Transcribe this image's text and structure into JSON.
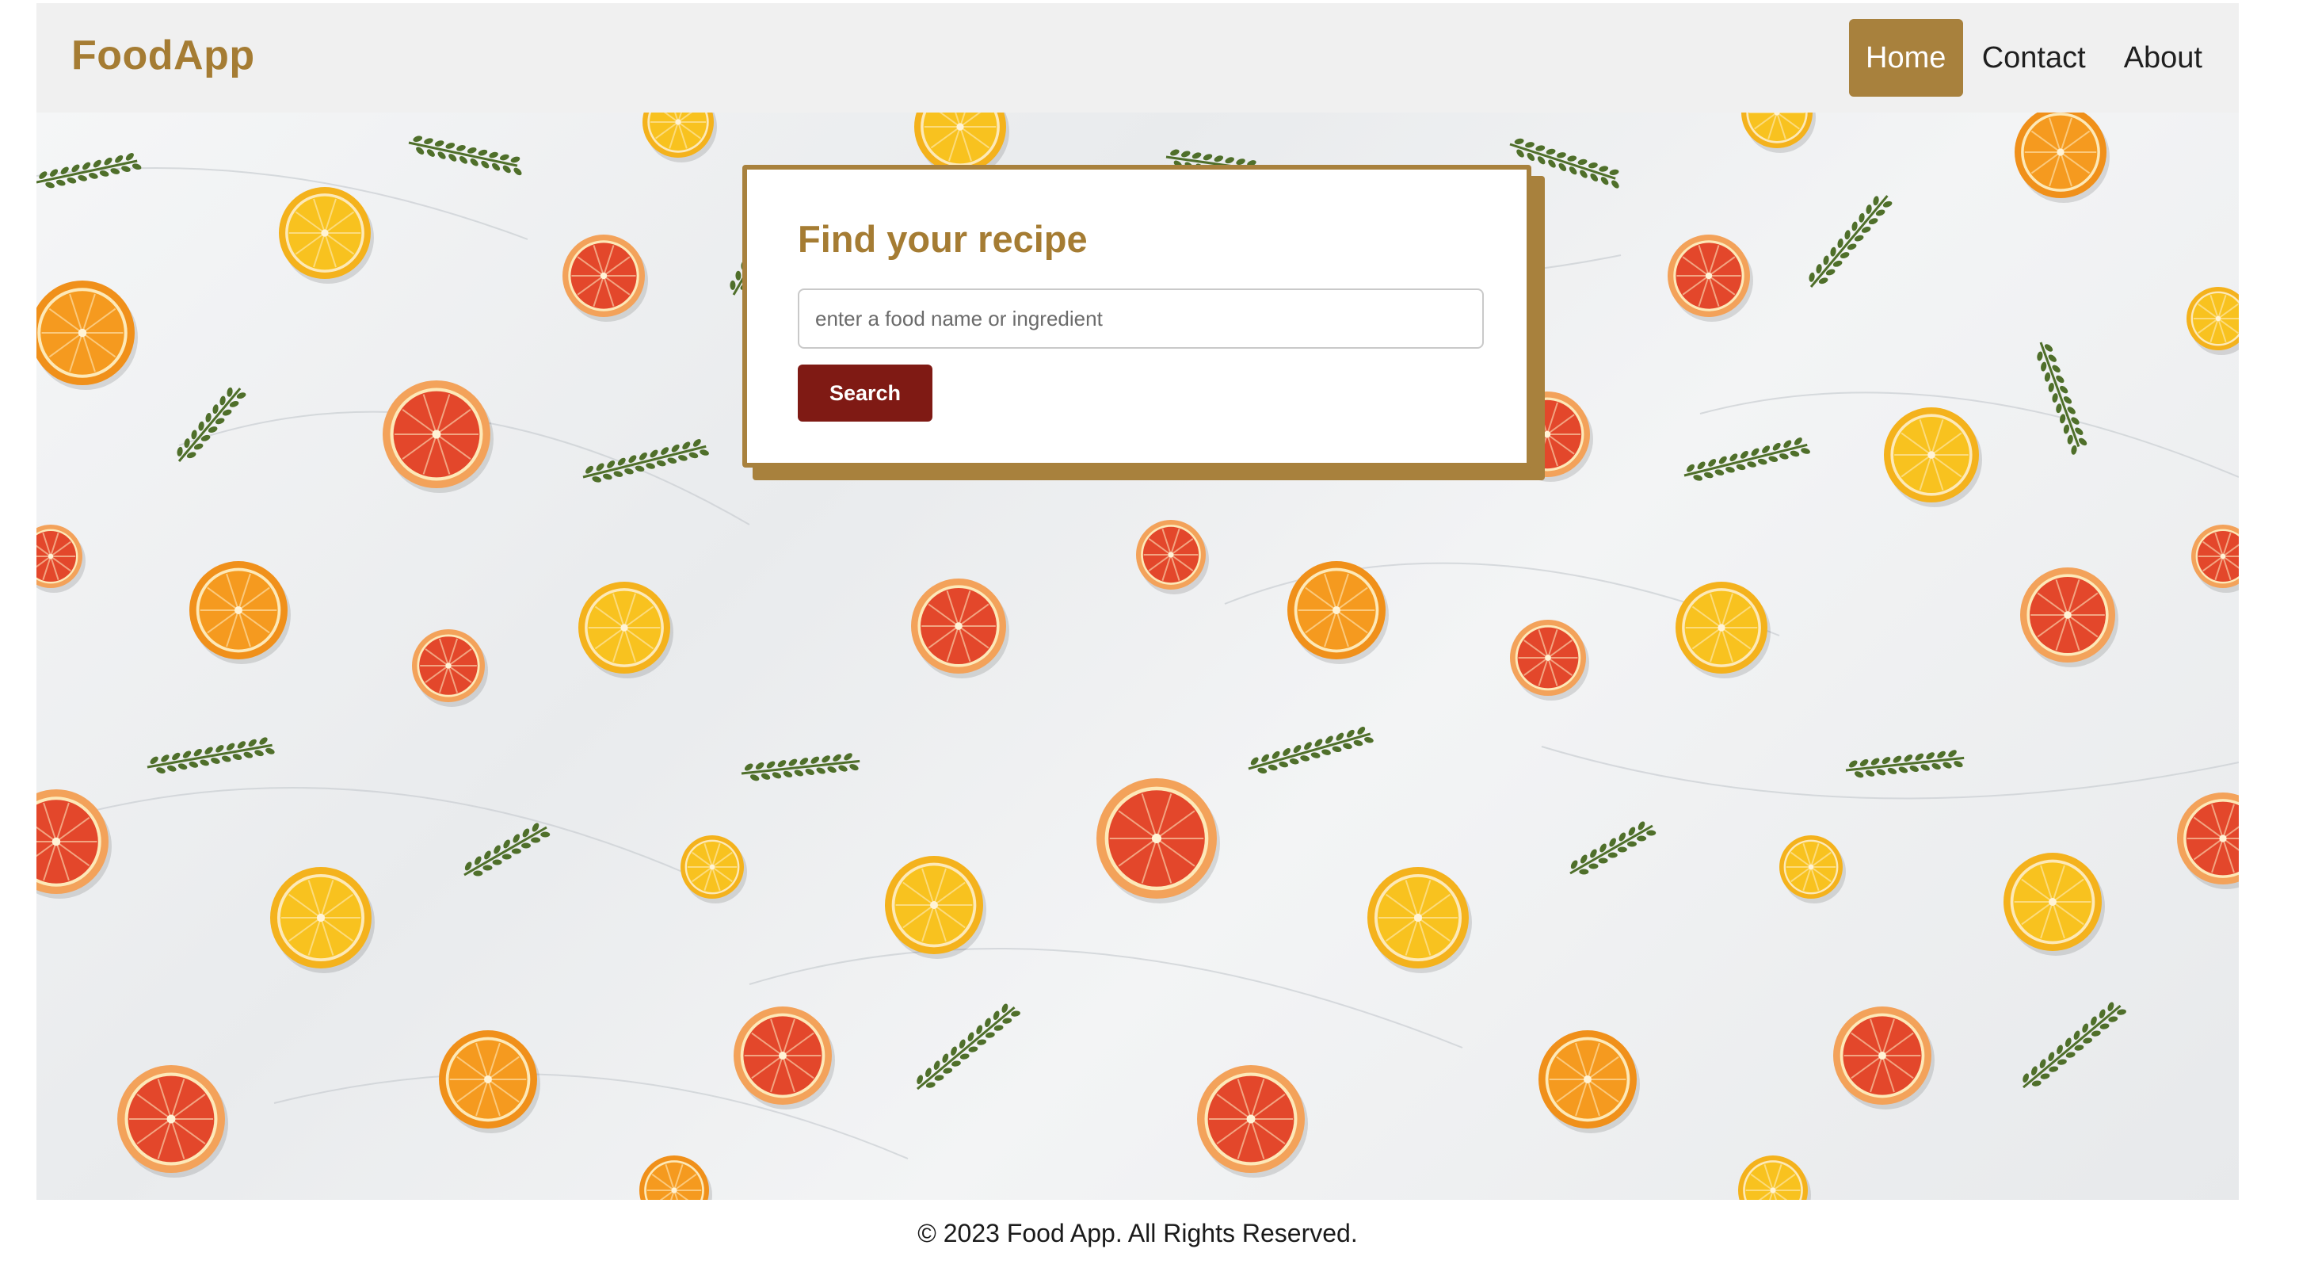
{
  "brand": {
    "name": "FoodApp"
  },
  "nav": {
    "items": [
      {
        "label": "Home",
        "active": true
      },
      {
        "label": "Contact",
        "active": false
      },
      {
        "label": "About",
        "active": false
      }
    ]
  },
  "search": {
    "title": "Find your recipe",
    "placeholder": "enter a food name or ingredient",
    "button_label": "Search"
  },
  "hero": {
    "background": "marble-with-citrus-slices-and-thyme",
    "colors": {
      "orange": "#f59a1f",
      "lemon": "#f8c21f",
      "grapefruit": "#e3472b",
      "thyme": "#4f6f2a"
    }
  },
  "footer": {
    "text": "© 2023 Food App. All Rights Reserved."
  },
  "colors": {
    "accent": "#a8813d",
    "brand_text": "#a57c33",
    "button": "#7f1a14",
    "navbar_bg": "#f0f0f0"
  }
}
